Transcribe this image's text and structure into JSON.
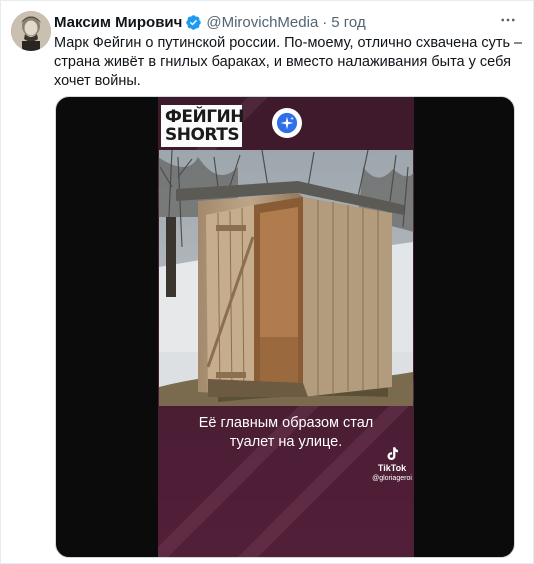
{
  "tweet": {
    "author_name": "Максим Мирович",
    "handle": "@MirovichMedia",
    "separator": "·",
    "time": "5 год",
    "text_lines": [
      "Марк Фейгин о путинской россии. По-моему, отлично схвачена суть –",
      "страна живёт в гнилых бараках, и вместо налаживания быта у себя",
      "хочет войны."
    ]
  },
  "media": {
    "logo_line1": "ФЕЙГИН",
    "logo_line2": "SHORTS",
    "caption_line1": "Её главным образом стал",
    "caption_line2": "туалет на улице.",
    "tiktok_label": "TikTok",
    "tiktok_user": "@gloriageroi"
  },
  "colors": {
    "verified": "#1d9bf0",
    "muted_text": "#536471",
    "video_frame": "#4a1e34"
  },
  "icons": {
    "verified": "verified-badge-icon",
    "more": "more-options-icon",
    "ai": "sparkle-icon",
    "tiktok": "tiktok-logo-icon"
  }
}
